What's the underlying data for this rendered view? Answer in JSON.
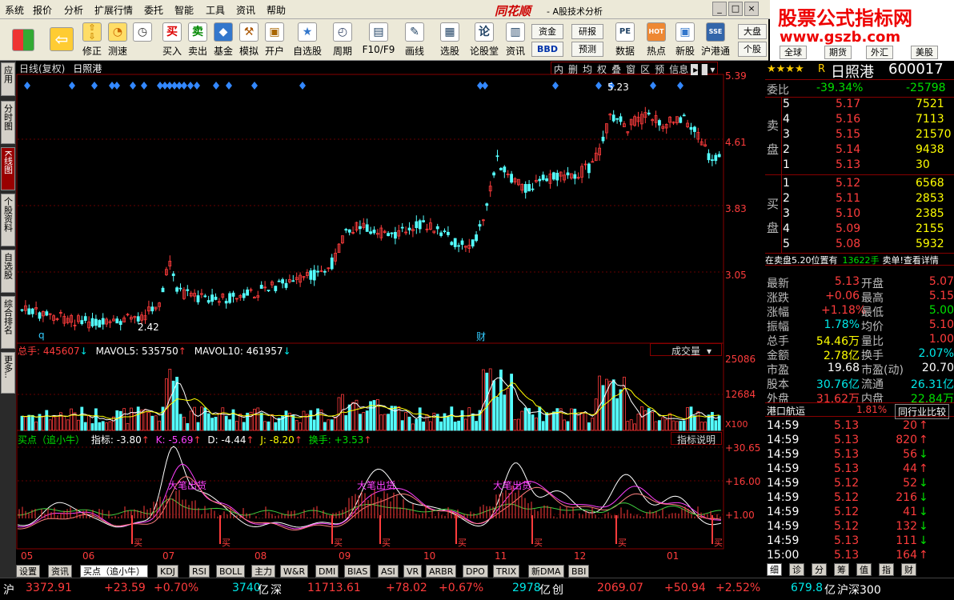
{
  "menu": {
    "items": [
      "系统",
      "报价",
      "分析",
      "扩展行情",
      "委托",
      "智能",
      "工具",
      "资讯",
      "帮助"
    ],
    "app_name": "同花顺",
    "subtitle": "- A股技术分析"
  },
  "toolbar": {
    "buttons": [
      {
        "label": "修正",
        "icon": "up-down-arrow-icon"
      },
      {
        "label": "测速",
        "icon": "stopwatch-icon"
      },
      {
        "label": "买入",
        "icon": "buy-icon",
        "glyph": "买"
      },
      {
        "label": "卖出",
        "icon": "sell-icon",
        "glyph": "卖"
      },
      {
        "label": "基金",
        "icon": "fund-icon"
      },
      {
        "label": "模拟",
        "icon": "hammer-icon"
      },
      {
        "label": "开户",
        "icon": "lock-icon"
      },
      {
        "label": "自选股",
        "icon": "star-folder-icon"
      },
      {
        "label": "周期",
        "icon": "clock-icon"
      },
      {
        "label": "F10/F9",
        "icon": "document-icon"
      },
      {
        "label": "画线",
        "icon": "pencil-icon"
      },
      {
        "label": "选股",
        "icon": "screen-icon"
      },
      {
        "label": "论股堂",
        "icon": "forum-icon",
        "glyph": "论"
      },
      {
        "label": "资讯",
        "icon": "news-icon"
      },
      {
        "label": "数据",
        "icon": "pe-icon",
        "glyph": "PE"
      },
      {
        "label": "热点",
        "icon": "hot-icon",
        "glyph": "HOT"
      },
      {
        "label": "新股",
        "icon": "new-stock-icon"
      },
      {
        "label": "沪港通",
        "icon": "sse-hke-icon",
        "glyph": "SSE"
      }
    ],
    "dropdowns": {
      "funds": "资金",
      "research": "研报",
      "bbd": "BBD",
      "forecast": "预测",
      "market": "大盘",
      "stock": "个股",
      "global": "全球",
      "futures": "期货",
      "foreign_exchange": "外汇",
      "hk": "美股"
    }
  },
  "watermark": {
    "line1": "股票公式指标网",
    "line2": "www.gszb.com"
  },
  "side_tabs": [
    "应用",
    "分时图",
    "K线图",
    "个股资料",
    "自选股",
    "综合排名",
    "更多.."
  ],
  "chart": {
    "period_label": "日线(复权)",
    "stock_name": "日照港",
    "toolbar_items": [
      "内",
      "删",
      "均",
      "权",
      "叠",
      "窗",
      "区",
      "预",
      "信息"
    ],
    "price_axis": [
      "5.39",
      "4.61",
      "3.83",
      "3.05"
    ],
    "high_label": "5.23",
    "low_label": "2.42",
    "markers": {
      "q": "q",
      "cai": "财"
    },
    "volume_legend": {
      "total": "总手: 445607",
      "ma5": "MAVOL5: 535750",
      "ma10": "MAVOL10: 461957"
    },
    "volume_selector": "成交量",
    "volume_axis": [
      "25086",
      "12684",
      "X100"
    ],
    "ind_legend": {
      "name": "买点（追小牛）",
      "ind": "指标: -3.80",
      "k": "K: -5.69",
      "d": "D: -4.44",
      "j": "J: -8.20",
      "hs": "换手: +3.53"
    },
    "ind_button": "指标说明",
    "ind_axis": [
      "+30.65",
      "+16.00",
      "+1.00"
    ],
    "ind_annotation": "大笔出货",
    "buy_label": "买",
    "months": [
      "05",
      "06",
      "07",
      "08",
      "09",
      "10",
      "11",
      "12",
      "01"
    ],
    "colors": {
      "up": "#ff3c3c",
      "down": "#54ffff",
      "ma5": "#ffffff",
      "ma10": "#ffff00",
      "k": "#ffffff",
      "d": "#ff40ff",
      "j": "#ffff88"
    }
  },
  "bottom_tabs": [
    "设置",
    "资讯",
    "买点（追小牛）",
    "KDJ",
    "RSI",
    "BOLL",
    "主力",
    "W&R",
    "DMI",
    "BIAS",
    "ASI",
    "VR",
    "ARBR",
    "DPO",
    "TRIX",
    "新DMA",
    "BBI"
  ],
  "status": {
    "sh_label": "沪",
    "sh_index": "3372.91",
    "sh_chg": "+23.59",
    "sh_pct": "+0.70%",
    "sh_amt": "3740",
    "amt_unit": "亿",
    "sz_label": "深",
    "sz_index": "11713.61",
    "sz_chg": "+78.02",
    "sz_pct": "+0.67%",
    "sz_amt": "2978",
    "cy_label": "创",
    "cy_index": "2069.07",
    "cy_chg": "+50.94",
    "cy_pct": "+2.52%",
    "hs_amt": "679.8",
    "hs_label": "沪深300"
  },
  "quote": {
    "rating": "★★★★",
    "r": "R",
    "name": "日照港",
    "code": "600017",
    "weibi_label": "委比",
    "weibi": "-39.34%",
    "weicha": "-25798",
    "sell_label1": "卖",
    "sell_label2": "盘",
    "buy_label1": "买",
    "buy_label2": "盘",
    "sells": [
      {
        "lvl": "5",
        "p": "5.17",
        "v": "7521"
      },
      {
        "lvl": "4",
        "p": "5.16",
        "v": "7113"
      },
      {
        "lvl": "3",
        "p": "5.15",
        "v": "21570"
      },
      {
        "lvl": "2",
        "p": "5.14",
        "v": "9438"
      },
      {
        "lvl": "1",
        "p": "5.13",
        "v": "30"
      }
    ],
    "buys": [
      {
        "lvl": "1",
        "p": "5.12",
        "v": "6568"
      },
      {
        "lvl": "2",
        "p": "5.11",
        "v": "2853"
      },
      {
        "lvl": "3",
        "p": "5.10",
        "v": "2385"
      },
      {
        "lvl": "4",
        "p": "5.09",
        "v": "2155"
      },
      {
        "lvl": "5",
        "p": "5.08",
        "v": "5932"
      }
    ],
    "notice_a": "在卖盘5.20位置有",
    "notice_b": "13622手",
    "notice_c": "卖单!查看详情",
    "stats": [
      {
        "l": "最新",
        "v": "5.13",
        "l2": "开盘",
        "v2": "5.07"
      },
      {
        "l": "涨跌",
        "v": "+0.06",
        "l2": "最高",
        "v2": "5.15"
      },
      {
        "l": "涨幅",
        "v": "+1.18%",
        "l2": "最低",
        "v2": "5.00"
      },
      {
        "l": "振幅",
        "v": "1.78%",
        "l2": "均价",
        "v2": "5.10"
      },
      {
        "l": "总手",
        "v": "54.46万",
        "l2": "量比",
        "v2": "1.00"
      },
      {
        "l": "金额",
        "v": "2.78亿",
        "l2": "换手",
        "v2": "2.07%"
      },
      {
        "l": "市盈",
        "v": "19.68",
        "l2": "市盈(动)",
        "v2": "20.70"
      },
      {
        "l": "股本",
        "v": "30.76亿",
        "l2": "流通",
        "v2": "26.31亿"
      },
      {
        "l": "外盘",
        "v": "31.62万",
        "l2": "内盘",
        "v2": "22.84万"
      }
    ],
    "industry": "港口航运",
    "industry_pct": "1.81%",
    "industry_btn": "同行业比较",
    "ticks": [
      {
        "t": "14:59",
        "p": "5.13",
        "v": "20",
        "d": "up"
      },
      {
        "t": "14:59",
        "p": "5.13",
        "v": "820",
        "d": "up"
      },
      {
        "t": "14:59",
        "p": "5.13",
        "v": "56",
        "d": "down"
      },
      {
        "t": "14:59",
        "p": "5.13",
        "v": "44",
        "d": "up"
      },
      {
        "t": "14:59",
        "p": "5.12",
        "v": "52",
        "d": "down"
      },
      {
        "t": "14:59",
        "p": "5.12",
        "v": "216",
        "d": "down"
      },
      {
        "t": "14:59",
        "p": "5.12",
        "v": "41",
        "d": "down"
      },
      {
        "t": "14:59",
        "p": "5.12",
        "v": "132",
        "d": "down"
      },
      {
        "t": "14:59",
        "p": "5.13",
        "v": "111",
        "d": "down"
      },
      {
        "t": "15:00",
        "p": "5.13",
        "v": "164",
        "d": "up"
      }
    ],
    "rtabs": [
      "细",
      "诊",
      "分",
      "筹",
      "值",
      "指",
      "财"
    ]
  }
}
